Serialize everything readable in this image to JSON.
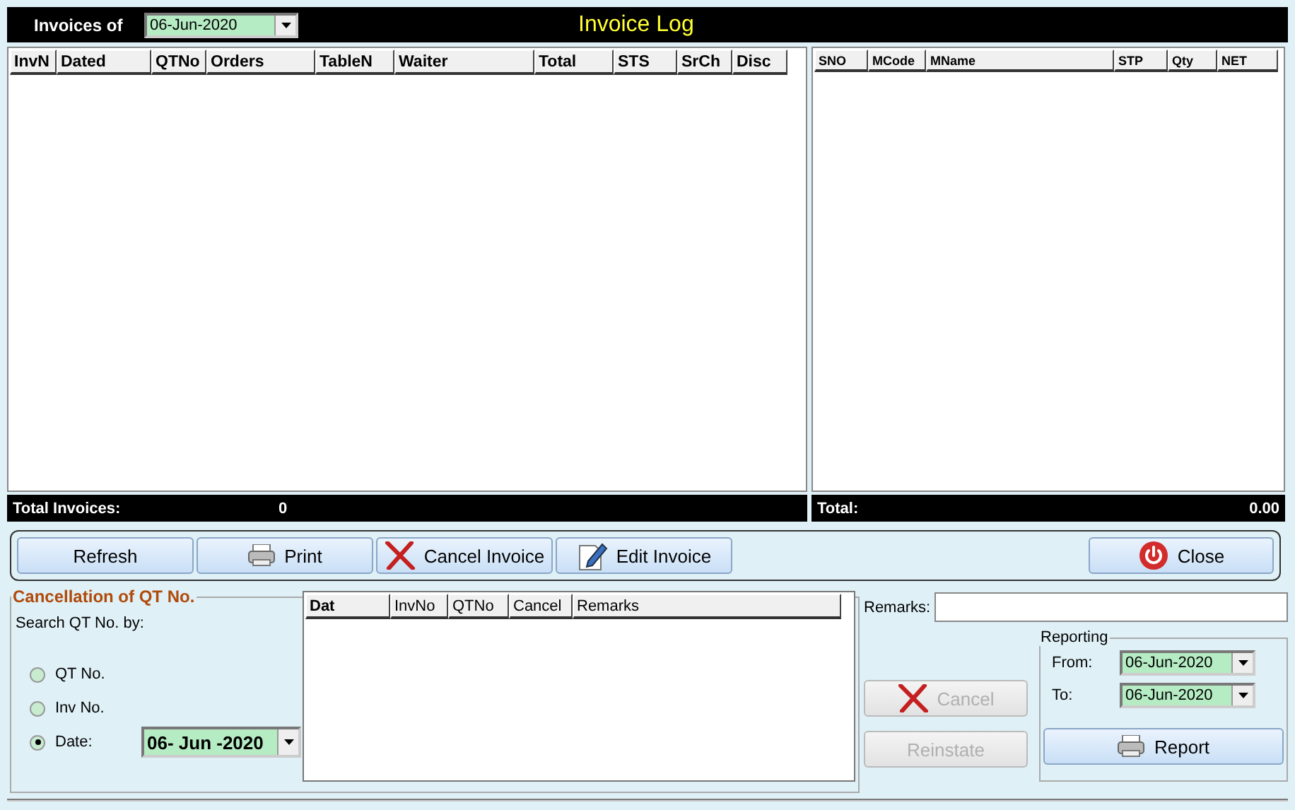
{
  "header": {
    "label": "Invoices of",
    "date": "06-Jun-2020",
    "title": "Invoice Log"
  },
  "invoices_table": {
    "columns": [
      "InvN",
      "Dated",
      "QTNo",
      "Orders",
      "TableN",
      "Waiter",
      "Total",
      "STS",
      "SrCh",
      "Disc"
    ]
  },
  "items_table": {
    "columns": [
      "SNO",
      "MCode",
      "MName",
      "STP",
      "Qty",
      "NET"
    ]
  },
  "totals": {
    "invoices_label": "Total Invoices:",
    "invoices_count": "0",
    "total_label": "Total:",
    "total_value": "0.00"
  },
  "toolbar": {
    "buttons": [
      {
        "label": "Refresh",
        "kind": "plain"
      },
      {
        "label": "Print",
        "kind": "print"
      },
      {
        "label": "Cancel Invoice",
        "kind": "cancel"
      },
      {
        "label": "Edit Invoice",
        "kind": "edit"
      }
    ],
    "close": {
      "label": "Close"
    }
  },
  "cancellation": {
    "title": "Cancellation of QT No.",
    "search_label": "Search QT No. by:",
    "options": [
      {
        "label": "QT No.",
        "selected": false
      },
      {
        "label": "Inv No.",
        "selected": false
      },
      {
        "label": "Date:",
        "selected": true
      }
    ],
    "date": "06- Jun -2020",
    "columns": [
      "Dat",
      "InvNo",
      "QTNo",
      "Cancel",
      "Remarks"
    ],
    "remarks_label": "Remarks:",
    "actions": [
      {
        "label": "Cancel",
        "kind": "cancel",
        "disabled": true
      },
      {
        "label": "Reinstate",
        "kind": "plain",
        "disabled": true
      }
    ],
    "reporting": {
      "title": "Reporting",
      "from_label": "From:",
      "from": "06-Jun-2020",
      "to_label": "To:",
      "to": "06-Jun-2020",
      "button": "Report"
    }
  }
}
